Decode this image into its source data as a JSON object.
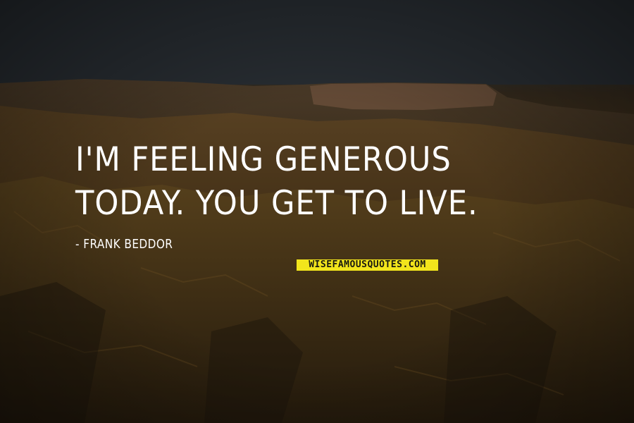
{
  "quote": {
    "text": "I'm feeling generous today. You get to live.",
    "author": "- Frank Beddor"
  },
  "watermark": {
    "text": "WISEFAMOUSQUOTES.COM",
    "color": "#f2e51c"
  },
  "background": {
    "subject": "canyon-landscape-at-dusk"
  }
}
